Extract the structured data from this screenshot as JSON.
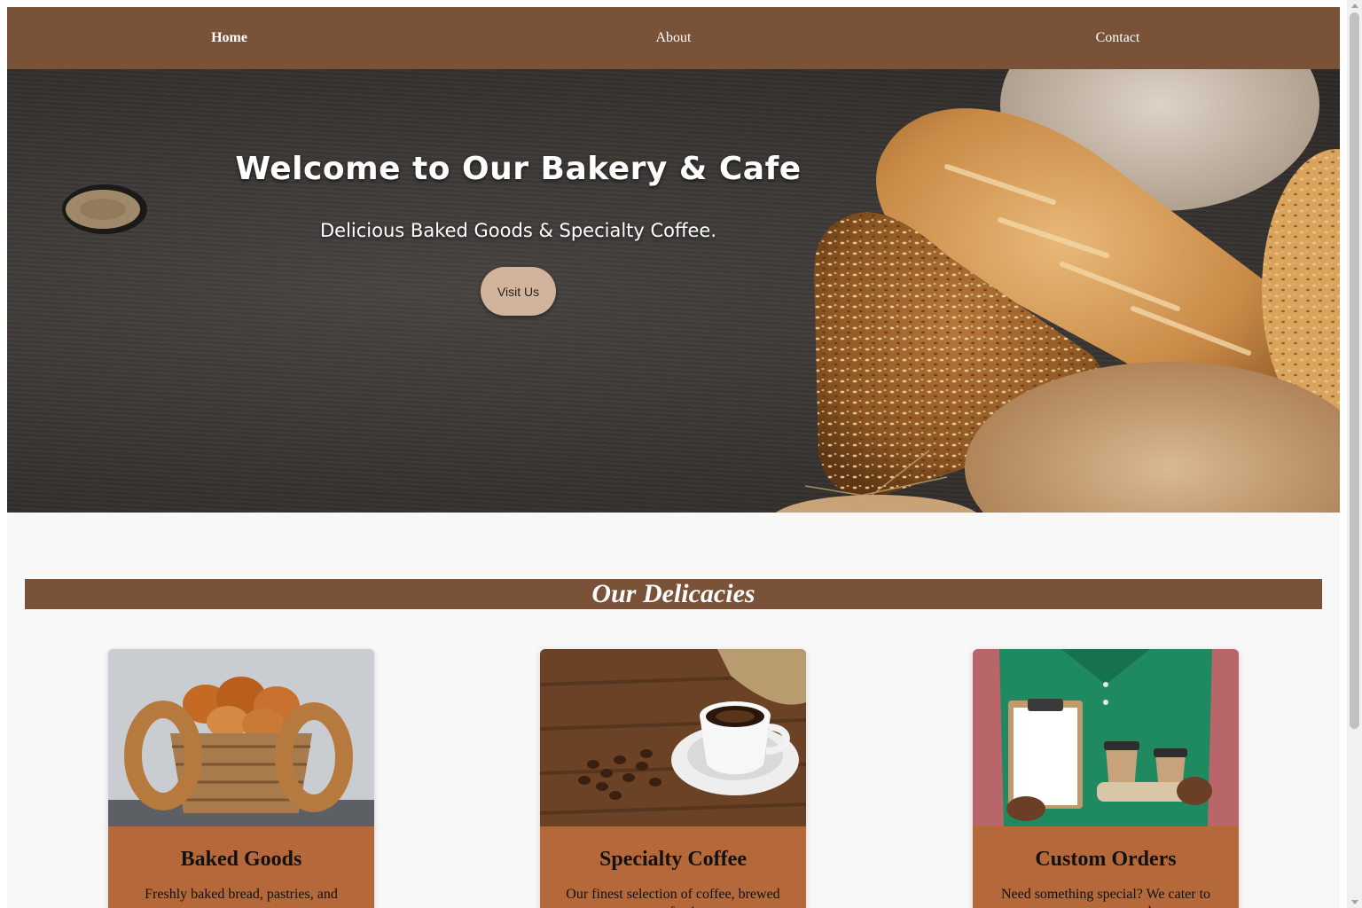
{
  "nav": {
    "items": [
      {
        "label": "Home",
        "active": true
      },
      {
        "label": "About",
        "active": false
      },
      {
        "label": "Contact",
        "active": false
      }
    ]
  },
  "hero": {
    "title": "Welcome to Our Bakery & Cafe",
    "subtitle": "Delicious Baked Goods & Specialty Coffee.",
    "button_label": "Visit Us"
  },
  "section": {
    "title": "Our Delicacies"
  },
  "cards": [
    {
      "title": "Baked Goods",
      "description": "Freshly baked bread, pastries, and more"
    },
    {
      "title": "Specialty Coffee",
      "description": "Our finest selection of coffee, brewed to perfection"
    },
    {
      "title": "Custom Orders",
      "description": "Need something special? We cater to your every need"
    }
  ],
  "colors": {
    "nav_bg": "#7a5238",
    "card_bg": "#b5683a",
    "button_bg": "#d2b49c",
    "page_bg": "#f8f8f8"
  }
}
